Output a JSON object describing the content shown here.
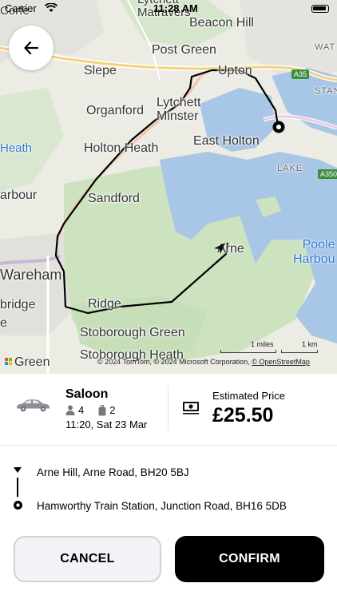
{
  "status_bar": {
    "carrier": "Carrier",
    "time": "11:28 AM"
  },
  "map": {
    "places": [
      {
        "id": "corfe",
        "name": "Corfe"
      },
      {
        "id": "lytchett-matravers",
        "name": "Lytchett\nMatravers"
      },
      {
        "id": "beacon-hill",
        "name": "Beacon Hill"
      },
      {
        "id": "post-green",
        "name": "Post Green"
      },
      {
        "id": "slepe",
        "name": "Slepe"
      },
      {
        "id": "upton",
        "name": "Upton"
      },
      {
        "id": "organford",
        "name": "Organford"
      },
      {
        "id": "lytchett-minster",
        "name": "Lytchett\nMinster"
      },
      {
        "id": "holton-heath",
        "name": "Holton Heath"
      },
      {
        "id": "east-holton",
        "name": "East Holton"
      },
      {
        "id": "heath",
        "name": "Heath"
      },
      {
        "id": "arbour",
        "name": "arbour"
      },
      {
        "id": "sandford",
        "name": "Sandford"
      },
      {
        "id": "arne",
        "name": "Arne"
      },
      {
        "id": "poole-harbour",
        "name": "Poole\nHarbou"
      },
      {
        "id": "wareham",
        "name": "Wareham"
      },
      {
        "id": "ridge",
        "name": "Ridge"
      },
      {
        "id": "bridge",
        "name": "bridge"
      },
      {
        "id": "stoborough-green",
        "name": "Stoborough Green"
      },
      {
        "id": "stoborough-heath",
        "name": "Stoborough Heath"
      },
      {
        "id": "green",
        "name": "Green"
      },
      {
        "id": "e",
        "name": "e"
      },
      {
        "id": "lake",
        "name": "LAKE"
      },
      {
        "id": "wat",
        "name": "WAT"
      },
      {
        "id": "stan",
        "name": "STAN"
      }
    ],
    "road_badges": {
      "a35": "A35",
      "a350": "A350"
    },
    "scale": {
      "miles": "1 miles",
      "km": "1 km"
    },
    "attribution": {
      "text": "© 2024 TomTom, © 2024 Microsoft Corporation, ",
      "link": "© OpenStreetMap"
    },
    "colors": {
      "water": "#a8c6e6",
      "green": "#cfe3c4",
      "land": "#ecece6",
      "route": "#000000"
    }
  },
  "vehicle": {
    "name": "Saloon",
    "passengers": "4",
    "luggage": "2",
    "datetime": "11:20, Sat 23 Mar"
  },
  "price": {
    "label": "Estimated Price",
    "value": "£25.50"
  },
  "route": {
    "pickup": "Arne Hill, Arne Road, BH20 5BJ",
    "dropoff": "Hamworthy Train Station, Junction Road, BH16 5DB"
  },
  "actions": {
    "cancel": "CANCEL",
    "confirm": "CONFIRM"
  },
  "icons": {
    "back": "arrow-left-icon",
    "car": "car-icon",
    "person": "person-icon",
    "luggage": "luggage-icon",
    "money": "banknote-icon",
    "pickup": "pickup-pin-icon",
    "dropoff": "dropoff-target-icon",
    "location": "navigation-arrow-icon"
  }
}
